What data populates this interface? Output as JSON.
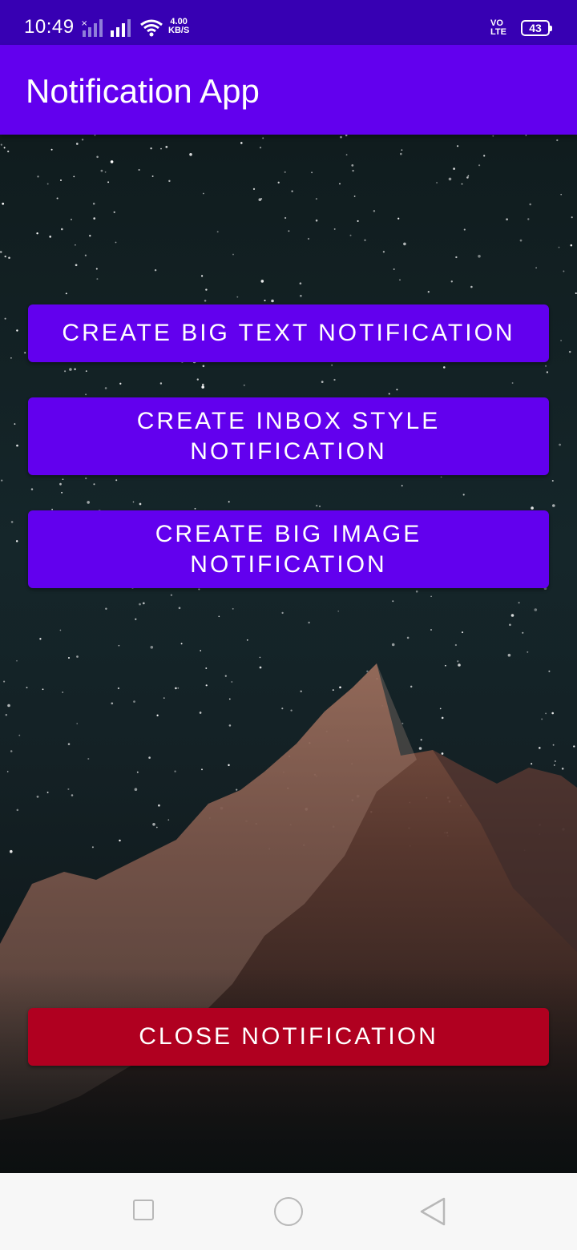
{
  "status_bar": {
    "time": "10:49",
    "net_speed_value": "4.00",
    "net_speed_unit": "KB/S",
    "volte_top": "VO",
    "volte_bottom": "LTE",
    "battery_level": "43"
  },
  "app_bar": {
    "title": "Notification App"
  },
  "buttons": {
    "big_text": "CREATE BIG TEXT NOTIFICATION",
    "inbox_style": "CREATE INBOX STYLE NOTIFICATION",
    "big_image": "CREATE BIG IMAGE NOTIFICATION",
    "close": "CLOSE NOTIFICATION"
  },
  "colors": {
    "status_bar": "#3700b3",
    "primary": "#6200ee",
    "danger": "#b00020",
    "nav_bar": "#f7f7f7"
  },
  "icons": {
    "signal_1": "cellular-signal-icon",
    "signal_2": "cellular-signal-icon",
    "wifi": "wifi-icon",
    "battery": "battery-icon",
    "nav_recents": "square-icon",
    "nav_home": "circle-icon",
    "nav_back": "triangle-back-icon"
  }
}
